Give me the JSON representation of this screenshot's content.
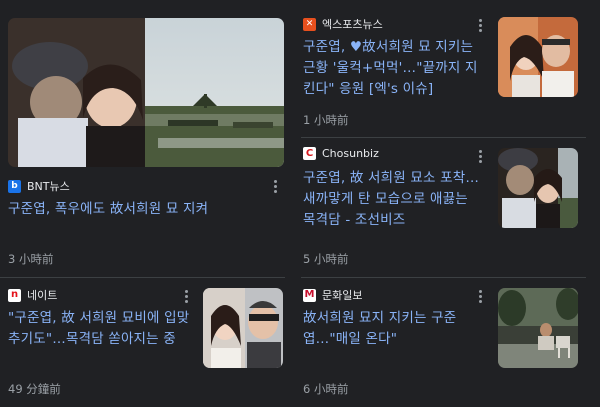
{
  "articles": [
    {
      "source": "BNT뉴스",
      "title": "구준엽, 폭우에도 故서희원 묘 지켜",
      "time": "3 小時前",
      "icon": "bnt-logo-icon",
      "icon_color": "#1a73e8"
    },
    {
      "source": "엑스포츠뉴스",
      "title": "구준엽, ♥故서희원 묘 지키는 근황 '울컥+먹먹'…\"끝까지 지킨다\" 응원 [엑's 이슈]",
      "time": "1 小時前",
      "icon": "xsports-logo-icon",
      "icon_color": "#e8501e"
    },
    {
      "source": "Chosunbiz",
      "title": "구준엽, 故 서희원 묘소 포착…새까맣게 탄 모습으로 애끓는 목격담 - 조선비즈",
      "time": "5 小時前",
      "icon": "chosun-logo-icon",
      "icon_color": "#d71a20"
    },
    {
      "source": "네이트",
      "title": "\"구준엽, 故 서희원 묘비에 입맞추기도\"…목격담 쏟아지는 중",
      "time": "49 分鐘前",
      "icon": "nate-logo-icon",
      "icon_color": "#e4141c"
    },
    {
      "source": "문화일보",
      "title": "故서희원 묘지 지키는 구준엽…\"매일 온다\"",
      "time": "6 小時前",
      "icon": "munhwa-logo-icon",
      "icon_color": "#c8102e"
    }
  ]
}
